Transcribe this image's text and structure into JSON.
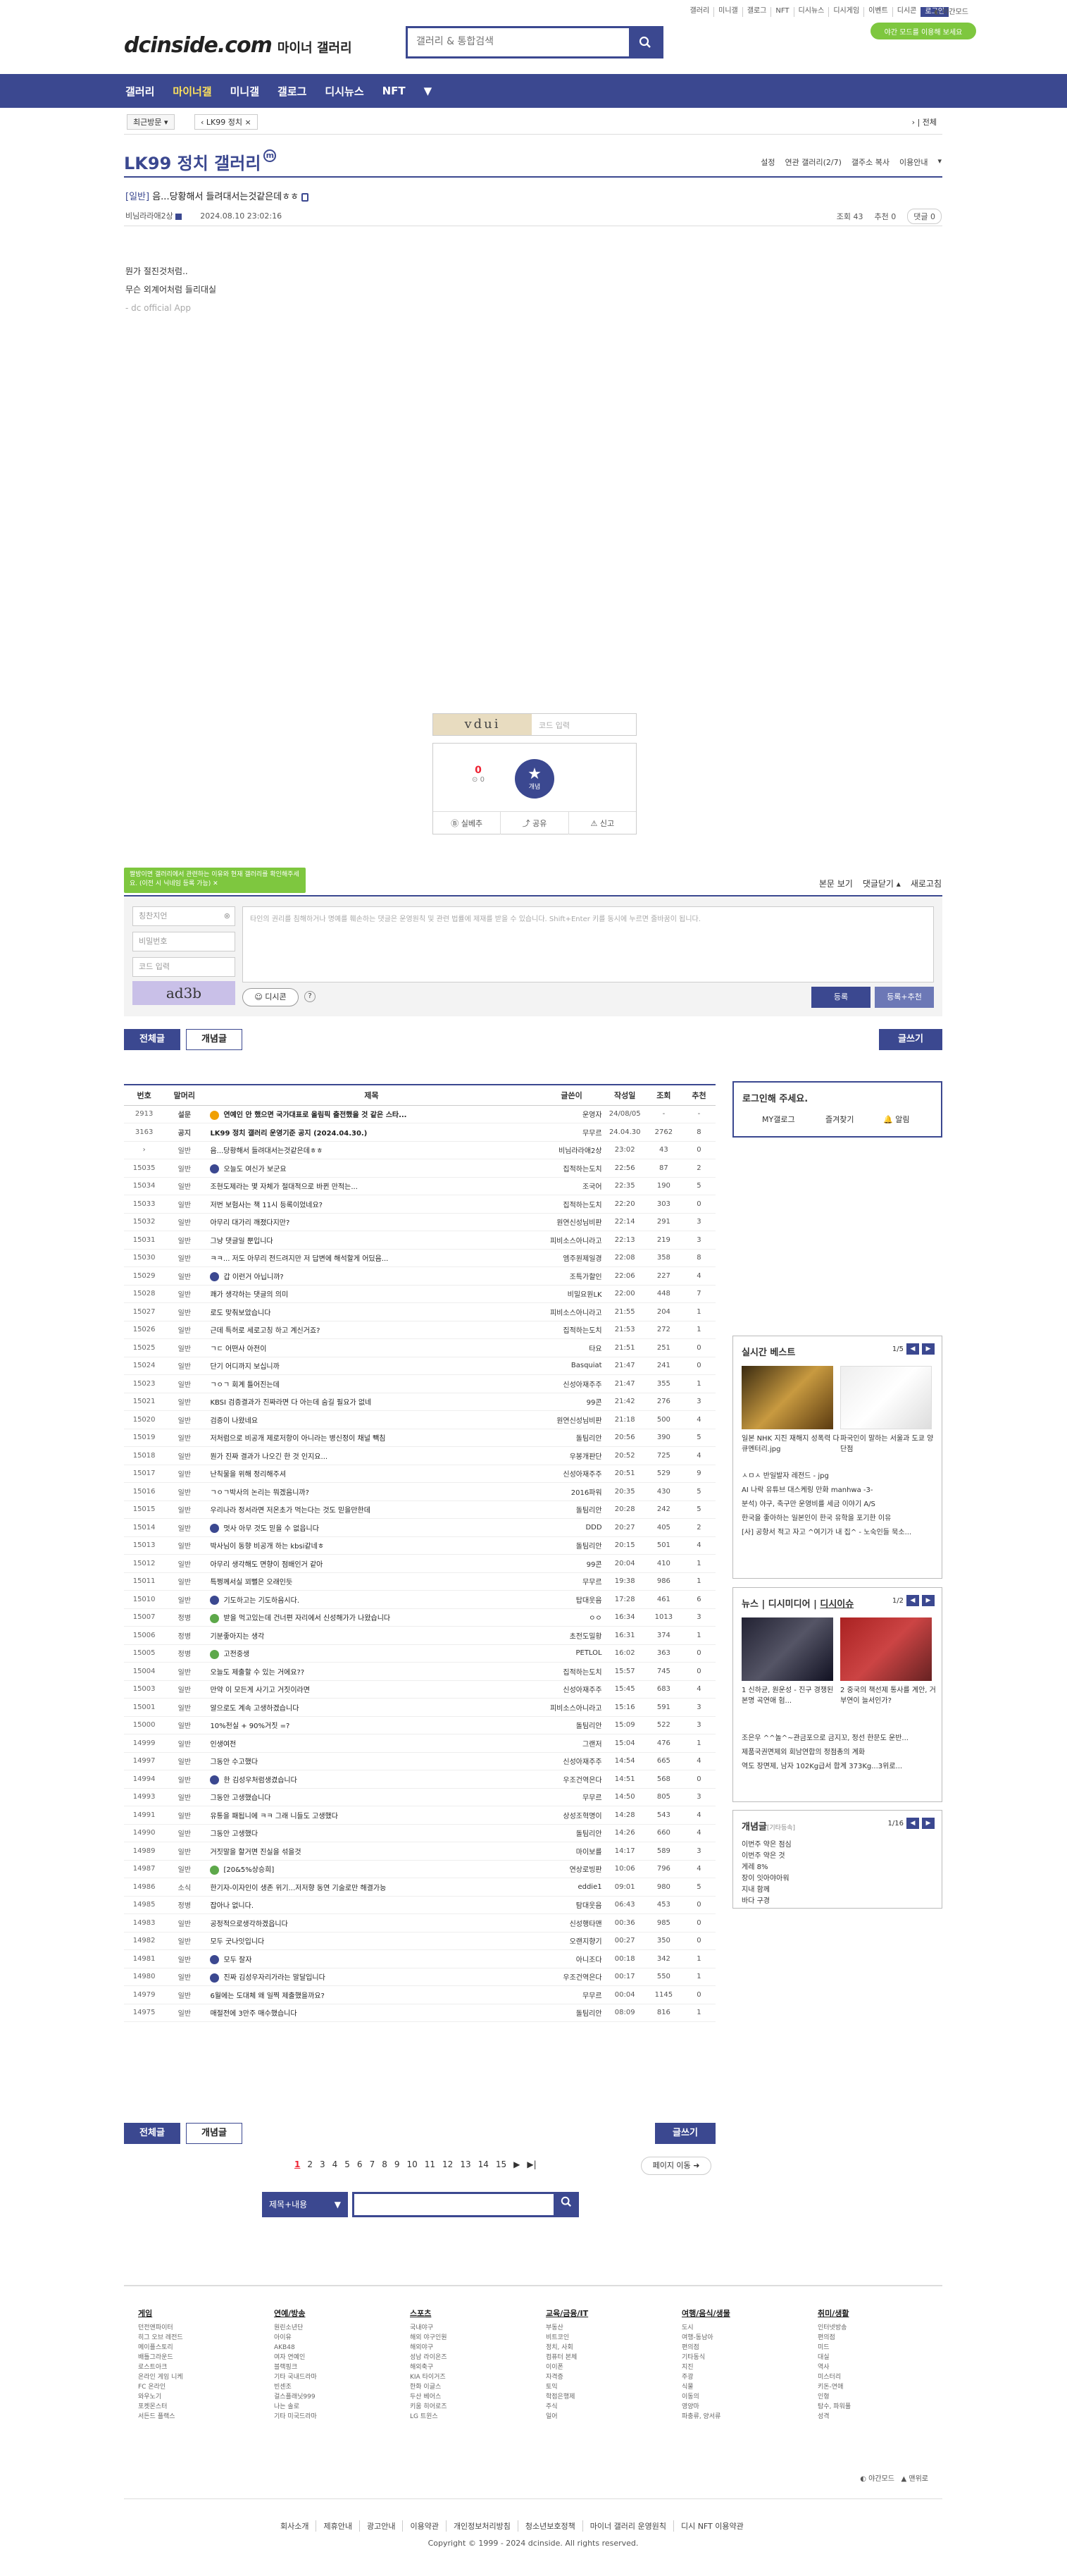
{
  "header": {
    "top_links": [
      "갤러리",
      "미니갤",
      "갤로그",
      "NFT",
      "디시뉴스",
      "디시게임",
      "이벤트",
      "디시콘",
      "로그인"
    ],
    "darkmode": "야간모드",
    "logo": "dcinside.com",
    "logo_sub": "마이너 갤러리",
    "search_placeholder": "갤러리 & 통합검색",
    "promo": "야간 모드를 이용해 보세요",
    "gnb": [
      "갤러리",
      "마이너갤",
      "미니갤",
      "갤로그",
      "디시뉴스",
      "NFT"
    ],
    "gnb_active": "마이너갤",
    "ticker": [
      "",
      ""
    ]
  },
  "subnav": {
    "recent": "최근방문",
    "gallery_tag": "LK99 정치",
    "all": "전체"
  },
  "gallery": {
    "title": "LK99 정치 갤러리",
    "badge": "m",
    "menu": [
      "설정",
      "연관 갤러리(2/7)",
      "갤주소 복사",
      "이용안내"
    ]
  },
  "post": {
    "head": "[일반]",
    "title": "음...당황해서 들려대서는것같은데ㅎㅎ",
    "author": "비님라라애2상",
    "date": "2024.08.10 23:02:16",
    "views": "조회 43",
    "recommends": "추천 0",
    "comments": "댓글 0",
    "body": [
      "뭔가 절진것처럼..",
      "무슨 외계어처럼 들리대실",
      "- dc official App"
    ],
    "captcha_img": "vdui",
    "captcha_ph": "코드 입력",
    "vote_up": "0",
    "vote_fix": "0",
    "star_label": "개념",
    "actions": [
      "실베추",
      "공유",
      "신고"
    ]
  },
  "comment": {
    "bubble": "짤방이면 갤러리에서 관련하는 이유와 현재 갤러리를 확인해주세요. (이전 시 닉네임 등록 가능)",
    "controls": [
      "본문 보기",
      "댓글닫기",
      "새로고침"
    ],
    "nick_ph": "칭찬지언",
    "pw_ph": "비밀번호",
    "code_ph": "코드 입력",
    "text_ph": "타인의 권리를 침해하거나 명예를 훼손하는 댓글은 운영원칙 및 관련 법률에 제재를 받을 수 있습니다. Shift+Enter 키를 동시에 누르면 줄바꿈이 됩니다.",
    "captcha": "ad3b",
    "dccon": "디시콘",
    "submit": "등록",
    "submit2": "등록+추천"
  },
  "board": {
    "btn_all": "전체글",
    "btn_concept": "개념글",
    "btn_write": "글쓰기",
    "headers": [
      "번호",
      "말머리",
      "제목",
      "글쓴이",
      "작성일",
      "조회",
      "추천"
    ],
    "rows": [
      [
        "2913",
        "설문",
        "o",
        "연예인 안 했으면 국가대표로 올림픽 출전했을 것 같은 스타...",
        "운영자",
        "24/08/05",
        "-",
        "-"
      ],
      [
        "3163",
        "공지",
        "",
        "LK99 정치 갤러리 운영기준 공지 (2024.04.30.)",
        "무무르",
        "24.04.30",
        "2762",
        "8"
      ],
      [
        "›",
        "일반",
        "",
        "음...당황해서 들려대서는것같은데ㅎㅎ",
        "비님라라애2상",
        "23:02",
        "43",
        "0"
      ],
      [
        "15035",
        "일반",
        "b",
        "오늘도 여신가 보군요",
        "집적하는도치",
        "22:56",
        "87",
        "2"
      ],
      [
        "15034",
        "일반",
        "",
        "조현도제라는 몇 자체가 절대적으로 바뀐 만적는...",
        "조국어",
        "22:35",
        "190",
        "5"
      ],
      [
        "15033",
        "일반",
        "",
        "저번 보험사는 책 11시 등록이었네요?",
        "집적하는도치",
        "22:20",
        "303",
        "0"
      ],
      [
        "15032",
        "일반",
        "",
        "아무리 대가리 깨졌다지만?",
        "원연신성님비판",
        "22:14",
        "291",
        "3"
      ],
      [
        "15031",
        "일반",
        "",
        "그냥 댓글일 뿐입니다",
        "피비소스아니라고",
        "22:13",
        "219",
        "3"
      ],
      [
        "15030",
        "일반",
        "",
        "ㅋㅋ... 저도 아무리 전드려지만 저 답변에 해석할게 어딨음...",
        "엠주원제일경",
        "22:08",
        "358",
        "8"
      ],
      [
        "15029",
        "일반",
        "b",
        "갑 이런거 아닙니까?",
        "조특가할인",
        "22:06",
        "227",
        "4"
      ],
      [
        "15028",
        "일반",
        "",
        "쾌가 생각하는 댓글의 의미",
        "비밀요원LK",
        "22:00",
        "448",
        "7"
      ],
      [
        "15027",
        "일반",
        "",
        "로도 맞춰보았습니다",
        "피비소스아니라고",
        "21:55",
        "204",
        "1"
      ],
      [
        "15026",
        "일반",
        "",
        "근데 특허로 세로고칭 하고 계신거죠?",
        "집적하는도치",
        "21:53",
        "272",
        "1"
      ],
      [
        "15025",
        "일반",
        "",
        "ㄱㄷ 어떤사 아전이",
        "타요",
        "21:51",
        "251",
        "0"
      ],
      [
        "15024",
        "일반",
        "",
        "단기 어디까지 보십니까",
        "Basquiat",
        "21:47",
        "241",
        "0"
      ],
      [
        "15023",
        "일반",
        "",
        "ㄱㅇㄱ 회계 틀어진는데",
        "신성아재주주",
        "21:47",
        "355",
        "1"
      ],
      [
        "15021",
        "일반",
        "",
        "KBSI 검증결과가 진짜라면 다 아는데 숨길 필요가 없네",
        "99콘",
        "21:42",
        "276",
        "3"
      ],
      [
        "15020",
        "일반",
        "",
        "검증이 나왔네요",
        "원연신성님비판",
        "21:18",
        "500",
        "4"
      ],
      [
        "15019",
        "일반",
        "",
        "저처럼으로 비공개 제로저항이 아니라는 병신정이 채널 빽침",
        "돌팀리안",
        "20:56",
        "390",
        "5"
      ],
      [
        "15018",
        "일반",
        "",
        "뭔가 진짜 결과가 나오긴 한 것 인지요...",
        "우봉개판단",
        "20:52",
        "725",
        "4"
      ],
      [
        "15017",
        "일반",
        "",
        "난칙물을 위해 정리해주셔",
        "신성아재주주",
        "20:51",
        "529",
        "9"
      ],
      [
        "15016",
        "일반",
        "",
        "ㄱㅇㄱ박사의 논리는 뭐겠음니까?",
        "2016파워",
        "20:35",
        "430",
        "5"
      ],
      [
        "15015",
        "일반",
        "",
        "우리나라 정서라면 저온초가 먹는다는 것도 믿을만한데",
        "돌팀리안",
        "20:28",
        "242",
        "5"
      ],
      [
        "15014",
        "일반",
        "b",
        "멋사 아무 것도 믿을 수 없읍니다",
        "DDD",
        "20:27",
        "405",
        "2"
      ],
      [
        "15013",
        "일반",
        "",
        "박사님이 동향 비공개 하는 kbsi같네ㅎ",
        "돌팀리안",
        "20:15",
        "501",
        "4"
      ],
      [
        "15012",
        "일반",
        "",
        "아무리 생각해도 면향이 점배인거 같아",
        "99콘",
        "20:04",
        "410",
        "1"
      ],
      [
        "15011",
        "일반",
        "",
        "특쩡께서실 꾀뻘은 오래인듯",
        "무무르",
        "19:38",
        "986",
        "1"
      ],
      [
        "15010",
        "일반",
        "b",
        "기도하고는 기도하음시다.",
        "탑대웃음",
        "17:28",
        "461",
        "6"
      ],
      [
        "15007",
        "정병",
        "g",
        "받을 먹고있는데 건너편 자리에서 신성해가가 나왔습니다",
        "ㅇㅇ",
        "16:34",
        "1013",
        "3"
      ],
      [
        "15006",
        "정병",
        "",
        "기분좋아지는 생각",
        "초전도밀황",
        "16:31",
        "374",
        "1"
      ],
      [
        "15005",
        "정병",
        "g",
        "고전중생",
        "PETLOL",
        "16:02",
        "363",
        "0"
      ],
      [
        "15004",
        "일반",
        "",
        "오늘도 제출할 수 있는 거에요??",
        "집적하는도치",
        "15:57",
        "745",
        "0"
      ],
      [
        "15003",
        "일반",
        "",
        "만약 이 모든게 사기고 거짓이라면",
        "신성아재주주",
        "15:45",
        "683",
        "4"
      ],
      [
        "15001",
        "일반",
        "",
        "알으로도 계속 고생하겠습니다",
        "피비소스아니라고",
        "15:16",
        "591",
        "3"
      ],
      [
        "15000",
        "일반",
        "",
        "10%천실 + 90%거짓 =?",
        "돌팀리안",
        "15:09",
        "522",
        "3"
      ],
      [
        "14999",
        "일반",
        "",
        "인생여전",
        "그랜저",
        "15:04",
        "476",
        "1"
      ],
      [
        "14997",
        "일반",
        "",
        "그동안 수고했다",
        "신성아재주주",
        "14:54",
        "665",
        "4"
      ],
      [
        "14994",
        "일반",
        "b",
        "한 김성우처럼생겼습니다",
        "우조건역은다",
        "14:51",
        "568",
        "0"
      ],
      [
        "14993",
        "일반",
        "",
        "그동안 고생했습니다",
        "무무르",
        "14:50",
        "805",
        "3"
      ],
      [
        "14991",
        "일반",
        "",
        "유통을 패됩니에 ㅋㅋ 그래 니들도 고생했다",
        "상성조혁명이",
        "14:28",
        "543",
        "4"
      ],
      [
        "14990",
        "일반",
        "",
        "그동안 고생했다",
        "돌팀리안",
        "14:26",
        "660",
        "4"
      ],
      [
        "14989",
        "일반",
        "",
        "거짓말을 할거면 진실을 섞을것",
        "마이보를",
        "14:17",
        "589",
        "3"
      ],
      [
        "14987",
        "일반",
        "g",
        "[20&5%상승희]",
        "연상로빙판",
        "10:06",
        "796",
        "4"
      ],
      [
        "14986",
        "소식",
        "",
        "한기자-이자인이 생존 위기...저저향 동연 기술로만 해결가능",
        "eddie1",
        "09:01",
        "980",
        "5"
      ],
      [
        "14985",
        "정병",
        "",
        "잡아나 없니다.",
        "탐대웃음",
        "06:43",
        "453",
        "0"
      ],
      [
        "14983",
        "일반",
        "",
        "공정적으로생각하겠읍니다",
        "신성행타맨",
        "00:36",
        "985",
        "0"
      ],
      [
        "14982",
        "일반",
        "",
        "모두 굿나잇입니다",
        "오랜지향기",
        "00:27",
        "350",
        "0"
      ],
      [
        "14981",
        "일반",
        "b",
        "모두 잘자",
        "아니조다",
        "00:18",
        "342",
        "1"
      ],
      [
        "14980",
        "일반",
        "b",
        "진짜 김성우자리가라는 말달입니다",
        "우조건역은다",
        "00:17",
        "550",
        "1"
      ],
      [
        "14979",
        "일반",
        "",
        "6월에는 도대체 왜 일찍 제출했을까요?",
        "무무르",
        "00:04",
        "1145",
        "0"
      ],
      [
        "14975",
        "일반",
        "",
        "매절전에 3만주 매수했습니다",
        "돌팀리안",
        "08:09",
        "816",
        "1"
      ]
    ]
  },
  "pagination": {
    "pages": [
      "1",
      "2",
      "3",
      "4",
      "5",
      "6",
      "7",
      "8",
      "9",
      "10",
      "11",
      "12",
      "13",
      "14",
      "15"
    ],
    "current": "1",
    "move": "페이지 이동"
  },
  "bottom_search": {
    "select": "제목+내용"
  },
  "sidebar": {
    "login": {
      "title": "로그인해 주세요.",
      "buttons": [
        "MY갤로그",
        "즐겨찾기",
        "알림"
      ]
    },
    "realtime": {
      "title": "실시간 베스트",
      "page": "1/5",
      "captions": [
        "일본 NHK 지진 재해지 성폭력 다큐멘터리.jpg",
        "파국인이 말하는 서울과 도쿄 양단점"
      ],
      "list": [
        "ㅅㅁㅅ 반일발자 레전드 - jpg",
        "AI 나락 유튜브 대스케링 만화 manhwa -3-",
        "분석) 야구, 축구만 운영비를 세금 이야기 A/S",
        "한국을 좋아하는 일본인이 한국 유학을 포기한 이유",
        "[사] 공항서 적고 자고 ^여기가 내 집^ - 노숙인들 묵소..."
      ]
    },
    "news": {
      "tabs": [
        "뉴스",
        "디시미디어",
        "디시이슈"
      ],
      "page": "1/2",
      "captions": [
        "신하균, 원운성 - 진구 경쟁된 본명 곡연애 험...",
        "중국의 책선제 통사를 계안, 거부연이 늘서인가?"
      ],
      "list": [
        "조은우 ^^놀^~관금포으로 금지꼬, 정선 한문도 운반...",
        "제품국권면제외 회남연합의 정점총의 계화",
        "역도 장면제, 남자 102Kg급서 합계 373Kg...3위로..."
      ]
    },
    "concept": {
      "title": "개념글",
      "title_sub": "[기타등속]",
      "page": "1/16",
      "list": [
        "이번주 약은 점심",
        "이번주 약은 것",
        "게레 8%",
        "장이 잇아야아워",
        "지내 함께",
        "바다 구경"
      ]
    }
  },
  "footer": {
    "columns": [
      {
        "h": "게임",
        "items": [
          "던전앤파이터",
          "히그 오브 레전드",
          "메이플스토리",
          "배틀그라운드",
          "로스트아크",
          "온라인 게임 니케",
          "FC 온라인",
          "와우노기",
          "포켓몬스터",
          "서든드 플랙스"
        ]
      },
      {
        "h": "연예/방송",
        "items": [
          "원린소년단",
          "아이유",
          "AKB48",
          "여자 연예인",
          "블랙핑크",
          "기타 국내드라마",
          "빈센조",
          "걸스플래닛999",
          "나는 솔로",
          "기타 미국드라마"
        ]
      },
      {
        "h": "스포츠",
        "items": [
          "국내야구",
          "해외 야구인원",
          "해외야구",
          "성남 라이온즈",
          "해외축구",
          "KIA 타이거즈",
          "한화 이글스",
          "두산 베어스",
          "키움 히어로즈",
          "LG 트윈스"
        ]
      },
      {
        "h": "교육/금융/IT",
        "items": [
          "부동산",
          "비트코인",
          "정치, 사회",
          "컴퓨터 본체",
          "이이폰",
          "자격증",
          "토익",
          "학점은행제",
          "주식",
          "일어"
        ]
      },
      {
        "h": "여행/음식/생물",
        "items": [
          "도시",
          "여행-동남아",
          "편의점",
          "기타동식",
          "지진",
          "주광",
          "식물",
          "이동의",
          "영양마",
          "파충류, 양서류"
        ]
      },
      {
        "h": "취미/생활",
        "items": [
          "인터넷방송",
          "편의점",
          "미드",
          "대실",
          "역사",
          "미스터리",
          "키돈-연애",
          "인형",
          "탐수, 파워풀",
          "성격"
        ]
      }
    ],
    "links": [
      "회사소개",
      "제휴안내",
      "광고안내",
      "이용약관",
      "개인정보처리방침",
      "청소년보호정책",
      "마이너 갤러리 운영원칙",
      "디시 NFT 이용약관"
    ],
    "copyright": "Copyright © 1999 - 2024 dcinside. All rights reserved.",
    "darkmode": "야간모드",
    "top": "맨위로"
  }
}
